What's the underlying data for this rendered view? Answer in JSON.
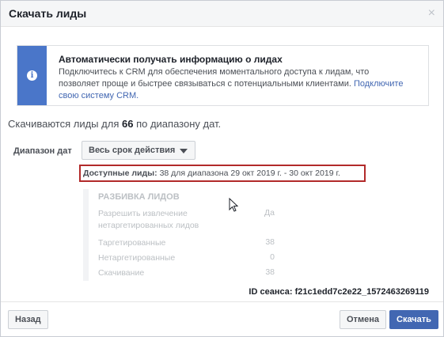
{
  "dialog": {
    "title": "Скачать лиды",
    "close_glyph": "×"
  },
  "banner": {
    "title": "Автоматически получать информацию о лидах",
    "text": "Подключитесь к CRM для обеспечения моментального доступа к лидам, что позволяет проще и быстрее связываться с потенциальными клиентами.",
    "link": "Подключите свою систему CRM.",
    "icon": "info-icon",
    "accent": "#4a76c9"
  },
  "summary": {
    "prefix": "Скачиваются лиды для",
    "count": "66",
    "suffix": "по диапазону дат."
  },
  "range": {
    "label": "Диапазон дат",
    "selected": "Весь срок действия"
  },
  "available": {
    "label": "Доступные лиды:",
    "count": "38",
    "text": "для диапазона 29 окт 2019 г. - 30 окт 2019 г.",
    "highlight_color": "#b22a2a"
  },
  "breakdown": {
    "title": "РАЗБИВКА ЛИДОВ",
    "rows": [
      {
        "label": "Разрешить извлечение нетаргетированных лидов",
        "value": "Да"
      },
      {
        "label": "Таргетированные",
        "value": "38"
      },
      {
        "label": "Нетаргетированные",
        "value": "0"
      },
      {
        "label": "Скачивание",
        "value": "38"
      }
    ]
  },
  "session": {
    "label": "ID сеанса:",
    "value": "f21c1edd7c2e22_1572463269119"
  },
  "footer": {
    "back": "Назад",
    "cancel": "Отмена",
    "download": "Скачать",
    "primary_color": "#4267b2"
  }
}
